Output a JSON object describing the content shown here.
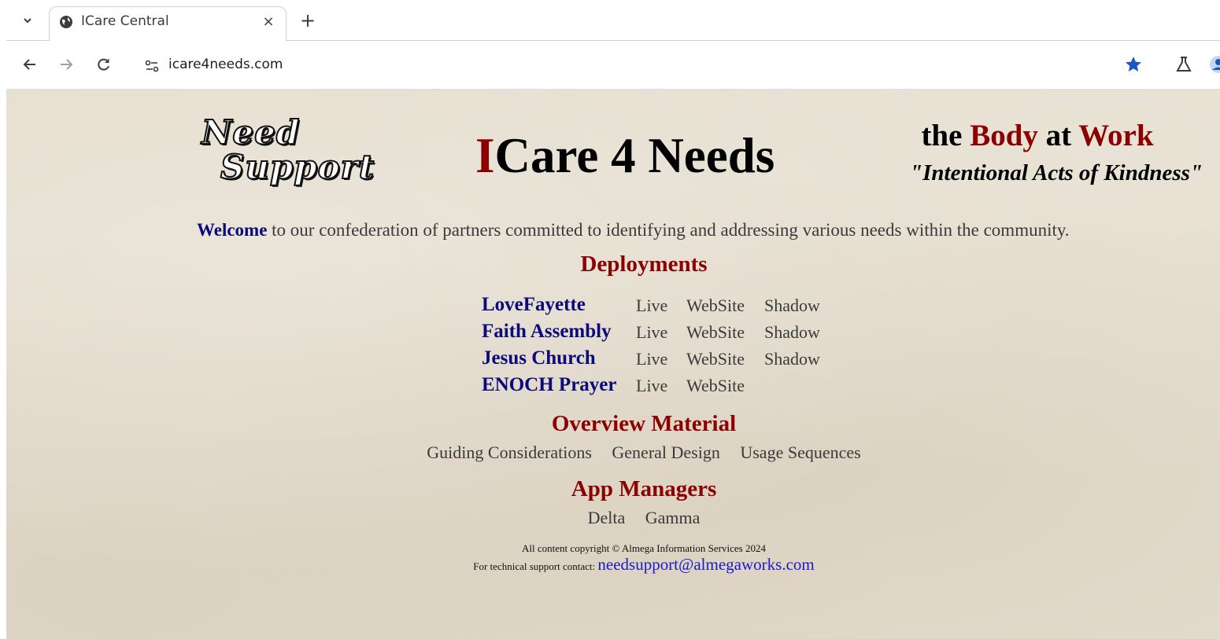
{
  "browser": {
    "tab_title": "ICare Central",
    "tab_close": "×",
    "new_tab": "+",
    "url": "icare4needs.com"
  },
  "header": {
    "logo_line1": "Need",
    "logo_line2": "Support",
    "title_first": "I",
    "title_rest": "Care 4 Needs",
    "tagline_the": "the ",
    "tagline_body": "Body",
    "tagline_at": " at ",
    "tagline_work": "Work",
    "motto": "\"Intentional Acts of Kindness\""
  },
  "welcome": {
    "lead": "Welcome",
    "text": " to our confederation of partners committed to identifying and addressing various needs within the community."
  },
  "deployments": {
    "title": "Deployments",
    "rows": [
      {
        "name": "LoveFayette",
        "live": "Live",
        "website": "WebSite",
        "shadow": "Shadow"
      },
      {
        "name": "Faith Assembly",
        "live": "Live",
        "website": "WebSite",
        "shadow": "Shadow"
      },
      {
        "name": "Jesus Church",
        "live": "Live",
        "website": "WebSite",
        "shadow": "Shadow"
      },
      {
        "name": "ENOCH Prayer",
        "live": "Live",
        "website": "WebSite",
        "shadow": ""
      }
    ]
  },
  "overview": {
    "title": "Overview Material",
    "links": [
      "Guiding Considerations",
      "General Design",
      "Usage Sequences"
    ]
  },
  "app_managers": {
    "title": "App Managers",
    "links": [
      "Delta",
      "Gamma"
    ]
  },
  "footer": {
    "copyright": "All content copyright © Almega Information Services 2024",
    "support_label": "For technical support contact: ",
    "support_email": "needsupport@almegaworks.com"
  },
  "colors": {
    "brand_red": "#8b0000",
    "brand_blue": "#0a0a7a",
    "page_bg": "#e4dccd",
    "link_blue": "#1a1acc"
  },
  "icons": [
    "tab-search-icon",
    "globe-icon",
    "close-icon",
    "plus-icon",
    "back-icon",
    "forward-icon",
    "reload-icon",
    "site-info-icon",
    "star-icon",
    "labs-icon",
    "profile-icon"
  ]
}
